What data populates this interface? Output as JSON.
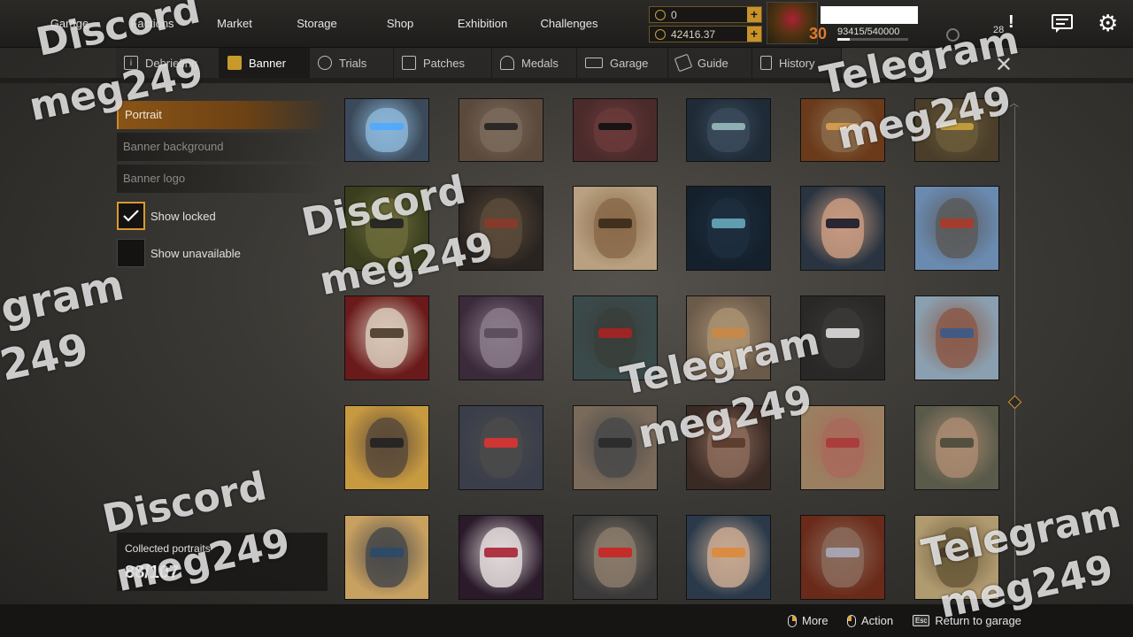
{
  "nav": {
    "items": [
      "Garage",
      "Factions",
      "Market",
      "Storage",
      "Shop",
      "Exhibition",
      "Challenges"
    ]
  },
  "resources": {
    "currency_1": "0",
    "currency_2": "42416.37",
    "level": "30",
    "xp": "93415/540000",
    "xp_fraction": 0.173,
    "notifications": "28"
  },
  "subtabs": [
    {
      "label": "Debriefing",
      "icon": "info-icon"
    },
    {
      "label": "Banner",
      "icon": "banner-icon"
    },
    {
      "label": "Trials",
      "icon": "target-icon"
    },
    {
      "label": "Patches",
      "icon": "patch-icon"
    },
    {
      "label": "Medals",
      "icon": "medal-icon"
    },
    {
      "label": "Garage",
      "icon": "garage-icon"
    },
    {
      "label": "Guide",
      "icon": "guide-icon"
    },
    {
      "label": "History",
      "icon": "history-icon"
    }
  ],
  "categories": [
    "Portrait",
    "Banner background",
    "Banner logo"
  ],
  "filters": {
    "show_locked": "Show locked",
    "show_unavailable": "Show unavailable"
  },
  "collected": {
    "label": "Collected portraits",
    "value": "88/107"
  },
  "portraits": [
    {
      "bg": "#3b4a5a",
      "fg": "#8ab4d6",
      "accent": "#4fa8ff"
    },
    {
      "bg": "#5b4a3c",
      "fg": "#7a6a5a",
      "accent": "#222"
    },
    {
      "bg": "#4a2a2a",
      "fg": "#6a3a3a",
      "accent": "#111"
    },
    {
      "bg": "#1e2a36",
      "fg": "#3a4a5a",
      "accent": "#9bb"
    },
    {
      "bg": "#6a3a1a",
      "fg": "#8a6a4a",
      "accent": "#dca050"
    },
    {
      "bg": "#4a3e2a",
      "fg": "#6a5a3a",
      "accent": "#c9a23d"
    },
    {
      "bg": "#3a3e1e",
      "fg": "#6a6a3a",
      "accent": "#222"
    },
    {
      "bg": "#2a2420",
      "fg": "#5a4a3a",
      "accent": "#8a3a2a"
    },
    {
      "bg": "#b8a080",
      "fg": "#8a6a4a",
      "accent": "#3a2a1a"
    },
    {
      "bg": "#14202c",
      "fg": "#1e2e3e",
      "accent": "#6ab"
    },
    {
      "bg": "#2a3440",
      "fg": "#c89a80",
      "accent": "#1a1a2a"
    },
    {
      "bg": "#6a8ab0",
      "fg": "#5a5a5a",
      "accent": "#aa3a2a"
    },
    {
      "bg": "#6a1a1a",
      "fg": "#d8c8b8",
      "accent": "#4a3a2a"
    },
    {
      "bg": "#3a2a3a",
      "fg": "#8a7a8a",
      "accent": "#5a4a5a"
    },
    {
      "bg": "#3a4a4a",
      "fg": "#3a3e3a",
      "accent": "#aa2222"
    },
    {
      "bg": "#6a5a4a",
      "fg": "#a89070",
      "accent": "#cc8844"
    },
    {
      "bg": "#2a2826",
      "fg": "#3a3836",
      "accent": "#ddd"
    },
    {
      "bg": "#8aa0b0",
      "fg": "#8a5a4a",
      "accent": "#3a5a8a"
    },
    {
      "bg": "#c89a40",
      "fg": "#5a4a3a",
      "accent": "#222"
    },
    {
      "bg": "#3a3e4a",
      "fg": "#4a4a4a",
      "accent": "#dd3333"
    },
    {
      "bg": "#7a6a5a",
      "fg": "#4a4a4a",
      "accent": "#2a2a2a"
    },
    {
      "bg": "#3a2a24",
      "fg": "#8a6a5a",
      "accent": "#5a3a2a"
    },
    {
      "bg": "#9a8060",
      "fg": "#a86a5a",
      "accent": "#aa3a3a"
    },
    {
      "bg": "#5a5a4a",
      "fg": "#a88a70",
      "accent": "#4a4a3a"
    },
    {
      "bg": "#c8a060",
      "fg": "#4a4a4a",
      "accent": "#2a4a6a"
    },
    {
      "bg": "#2a1a2a",
      "fg": "#e0d8d8",
      "accent": "#aa2233"
    },
    {
      "bg": "#3a3a3a",
      "fg": "#8a7a6a",
      "accent": "#cc2222"
    },
    {
      "bg": "#2a3a4a",
      "fg": "#c8a890",
      "accent": "#dd8a3a"
    },
    {
      "bg": "#6a2a1a",
      "fg": "#8a6a5a",
      "accent": "#aab"
    },
    {
      "bg": "#b09a70",
      "fg": "#6a5a3a",
      "accent": "#4a3a2a"
    }
  ],
  "bottom_hints": {
    "more": "More",
    "action": "Action",
    "esc_key": "Esc",
    "return": "Return to garage"
  },
  "watermarks": [
    {
      "text": "Discord"
    },
    {
      "text": "meg249"
    },
    {
      "text": "Telegram"
    },
    {
      "text": "meg249"
    },
    {
      "text": "Discord"
    },
    {
      "text": "meg249"
    },
    {
      "text": "gram"
    },
    {
      "text": "249"
    },
    {
      "text": "Telegram"
    },
    {
      "text": "meg249"
    },
    {
      "text": "Discord"
    },
    {
      "text": "meg249"
    },
    {
      "text": "Telegram"
    },
    {
      "text": "meg249"
    }
  ],
  "colors": {
    "accent_gold": "#d99a2d",
    "active_category": "#8a5416",
    "level_orange": "#e07a2e"
  }
}
